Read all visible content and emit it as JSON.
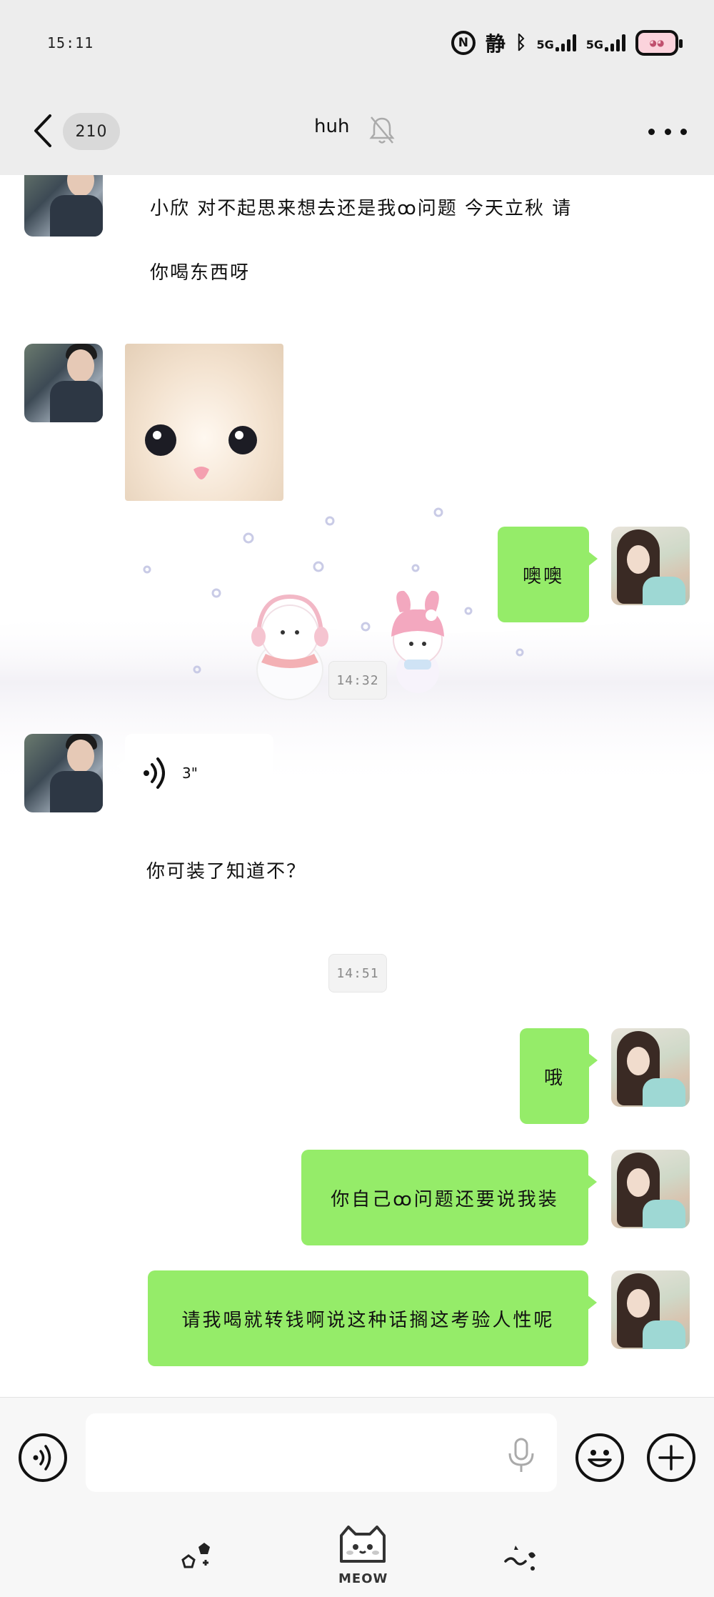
{
  "status_bar": {
    "time": "15:11",
    "badge_n": "N",
    "quiet_mode": "静",
    "net1": "5G",
    "net2": "5G"
  },
  "header": {
    "unread_count": "210",
    "title": "huh"
  },
  "messages": {
    "m1_line1": "小欣 对不起思来想去还是我ꝏ问题 今天立秋 请",
    "m1_line2": "你喝东西呀",
    "m2_text": "噢噢",
    "time1": "14:32",
    "voice_duration": "3\"",
    "m3_text": "你可装了知道不？",
    "time2": "14:51",
    "m4_text": "哦",
    "m5_text": "你自己ꝏ问题还要说我装",
    "m6_text": "请我喝就转钱啊说这种话搁这考验人性呢"
  },
  "input": {
    "placeholder": ""
  },
  "bottom_nav": {
    "center_label": "MEOW"
  },
  "colors": {
    "bubble_green": "#95ec69",
    "bar_bg": "#ededed"
  }
}
